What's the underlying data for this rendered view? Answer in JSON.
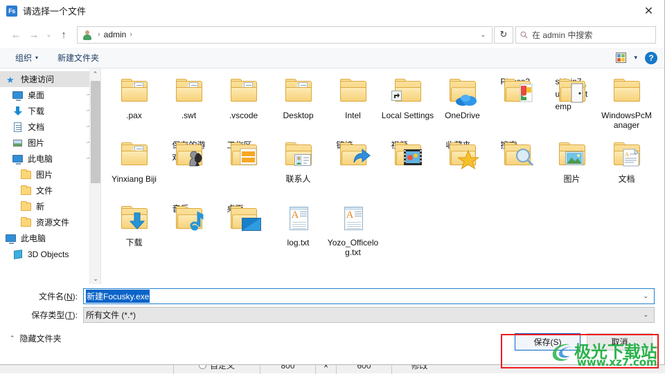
{
  "window": {
    "title": "请选择一个文件",
    "app_icon_text": "Fs",
    "close_label": "✕"
  },
  "nav": {
    "back": "←",
    "forward": "→",
    "recent": "⌄",
    "up": "↑",
    "breadcrumb": [
      "admin"
    ],
    "sep": "›",
    "dropdown": "⌄",
    "refresh": "↻",
    "search_placeholder": "在 admin 中搜索"
  },
  "commandbar": {
    "organize": "组织",
    "caret": "▾",
    "new_folder": "新建文件夹",
    "help": "?"
  },
  "sidebar": {
    "items": [
      {
        "label": "快速访问",
        "icon": "quick-access-star-icon",
        "indent": 0,
        "selected": true,
        "pinned": false
      },
      {
        "label": "桌面",
        "icon": "desktop-monitor-icon",
        "indent": 1,
        "selected": false,
        "pinned": true
      },
      {
        "label": "下载",
        "icon": "download-arrow-icon",
        "indent": 1,
        "selected": false,
        "pinned": true
      },
      {
        "label": "文档",
        "icon": "documents-icon",
        "indent": 1,
        "selected": false,
        "pinned": true
      },
      {
        "label": "图片",
        "icon": "pictures-icon",
        "indent": 1,
        "selected": false,
        "pinned": true
      },
      {
        "label": "此电脑",
        "icon": "this-pc-icon",
        "indent": 1,
        "selected": false,
        "pinned": true
      },
      {
        "label": "图片",
        "icon": "folder-icon",
        "indent": 2,
        "selected": false,
        "pinned": false
      },
      {
        "label": "文件",
        "icon": "folder-icon",
        "indent": 2,
        "selected": false,
        "pinned": false
      },
      {
        "label": "新",
        "icon": "folder-icon",
        "indent": 2,
        "selected": false,
        "pinned": false
      },
      {
        "label": "资源文件",
        "icon": "folder-icon",
        "indent": 2,
        "selected": false,
        "pinned": false
      },
      {
        "label": "此电脑",
        "icon": "this-pc-icon",
        "indent": 0,
        "selected": false,
        "pinned": false
      },
      {
        "label": "3D Objects",
        "icon": "3d-objects-icon",
        "indent": 1,
        "selected": false,
        "pinned": false
      }
    ],
    "scroll_up": "⌃",
    "scroll_down": "⌄"
  },
  "files": [
    {
      "name": ".pax",
      "icon": "folder-docs-icon"
    },
    {
      "name": ".swt",
      "icon": "folder-docs-icon"
    },
    {
      "name": ".vscode",
      "icon": "folder-docs-icon"
    },
    {
      "name": "Desktop",
      "icon": "folder-docs-icon"
    },
    {
      "name": "Intel",
      "icon": "folder-icon"
    },
    {
      "name": "Local Settings",
      "icon": "folder-shortcut-icon"
    },
    {
      "name": "OneDrive",
      "icon": "folder-onedrive-icon"
    },
    {
      "name": "Picasa3",
      "icon": "folder-picasa-icon"
    },
    {
      "name": "shipin7_update_temp",
      "icon": "folder-door-icon"
    },
    {
      "name": "WindowsPcManager",
      "icon": "folder-icon"
    },
    {
      "name": "Yinxiang Biji",
      "icon": "folder-docs-icon"
    },
    {
      "name": "保存的游戏",
      "icon": "folder-games-icon"
    },
    {
      "name": "工作区",
      "icon": "folder-workspace-icon"
    },
    {
      "name": "联系人",
      "icon": "folder-contacts-icon"
    },
    {
      "name": "链接",
      "icon": "folder-links-icon"
    },
    {
      "name": "视频",
      "icon": "folder-videos-icon"
    },
    {
      "name": "收藏夹",
      "icon": "folder-favorites-icon"
    },
    {
      "name": "搜索",
      "icon": "folder-search-icon"
    },
    {
      "name": "图片",
      "icon": "folder-pictures-icon"
    },
    {
      "name": "文档",
      "icon": "folder-documents-icon"
    },
    {
      "name": "下载",
      "icon": "folder-downloads-icon"
    },
    {
      "name": "音乐",
      "icon": "folder-music-icon"
    },
    {
      "name": "桌面",
      "icon": "folder-desktop-icon"
    },
    {
      "name": "log.txt",
      "icon": "text-document-icon"
    },
    {
      "name": "Yozo_Officelog.txt",
      "icon": "text-document-icon"
    }
  ],
  "form": {
    "filename_label": "文件名(N):",
    "filename_value": "新建Focusky.exe",
    "filetype_label": "保存类型(T):",
    "filetype_value": "所有文件 (*.*)",
    "dropdown_caret": "⌄"
  },
  "footer": {
    "hide_folders": "隐藏文件夹",
    "collapse_caret": "⌃",
    "save": "保存(S)",
    "cancel": "取消"
  },
  "watermark": {
    "main": "极光下载站",
    "sub": "www.xz7.com"
  },
  "background_window": {
    "custom_label": "自定义",
    "width_value": "800",
    "times": "×",
    "height_value": "600",
    "modify_label": "修改"
  },
  "colors": {
    "accent_blue": "#0a64c8",
    "annotation_red": "#f21b1b",
    "watermark_green": "#2bb24c",
    "folder_yellow": "#f6cf72"
  }
}
